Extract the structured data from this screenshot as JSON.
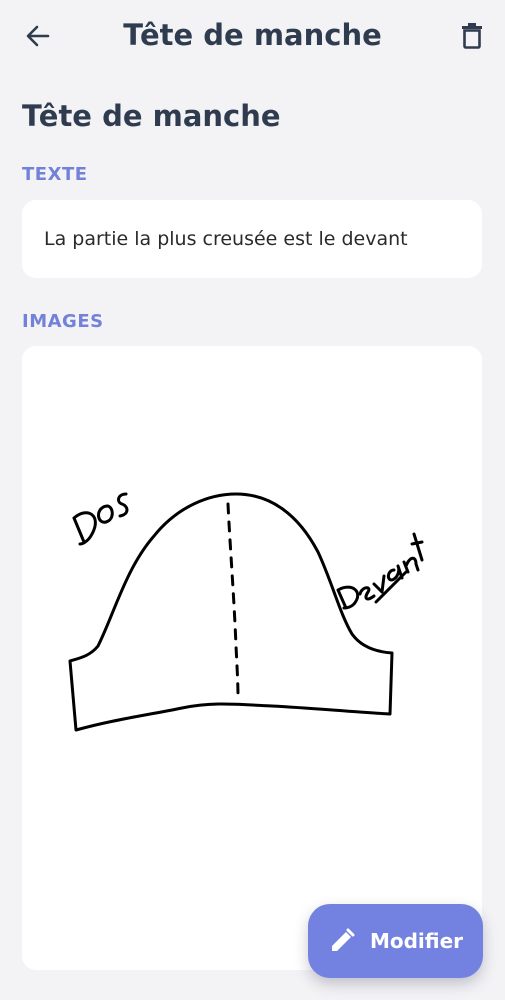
{
  "header": {
    "title": "Tête de manche",
    "back_icon": "arrow-left-icon",
    "delete_icon": "trash-icon"
  },
  "page": {
    "title": "Tête de manche"
  },
  "sections": {
    "texte_label": "TEXTE",
    "texte_value": "La partie la plus creusée est le devant",
    "images_label": "IMAGES"
  },
  "image": {
    "handwritten_labels": [
      "Dos",
      "Devant"
    ]
  },
  "fab": {
    "label": "Modifier",
    "icon": "pencil-icon"
  },
  "colors": {
    "background": "#f3f3f6",
    "accent": "#7382e0",
    "section_label": "#7382d9",
    "title_text": "#2f3b4e",
    "card": "#ffffff"
  }
}
